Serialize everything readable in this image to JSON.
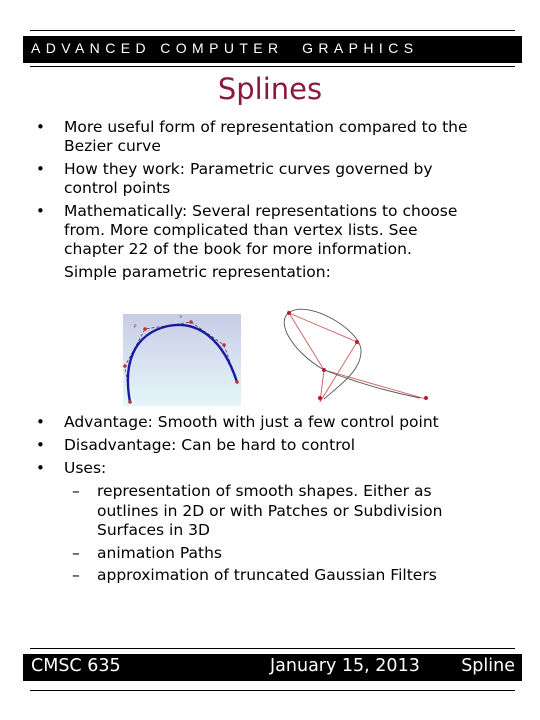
{
  "header": {
    "course_title": "ADVANCED COMPUTER  GRAPHICS"
  },
  "slide": {
    "title": "Splines",
    "bullets_top": [
      {
        "text": "More useful form of representation compared to the\nBezier curve"
      },
      {
        "text": "How they work: Parametric curves governed by\ncontrol points"
      },
      {
        "text": "Mathematically: Several representations to choose\nfrom. More complicated than vertex lists. See\nchapter 22 of the book for more information."
      }
    ],
    "continuation": "Simple parametric  representation:",
    "figures": [
      {
        "name": "b-spline-curve-figure",
        "description": "Blue spline curve with red control points on light gradient background"
      },
      {
        "name": "closed-spline-figure",
        "description": "Gray looping spline curve with red control polygon"
      }
    ],
    "bullets_bottom": [
      {
        "text": "Advantage: Smooth with just a few control point"
      },
      {
        "text": "Disadvantage: Can be hard to control"
      },
      {
        "text": "Uses:"
      }
    ],
    "sub_bullets": [
      {
        "text": "representation of smooth shapes. Either as\noutlines in 2D or with Patches or Subdivision\nSurfaces in 3D"
      },
      {
        "text": "animation Paths"
      },
      {
        "text": "approximation of truncated Gaussian Filters"
      }
    ],
    "bullet_glyph": "•",
    "dash_glyph": "–"
  },
  "footer": {
    "course": "CMSC 635",
    "date": "January 15, 2013",
    "topic": "Spline"
  },
  "colors": {
    "title": "#8b1a3a",
    "bar": "#000000",
    "curve_blue": "#1a1aa0",
    "control_red": "#c0303a"
  }
}
